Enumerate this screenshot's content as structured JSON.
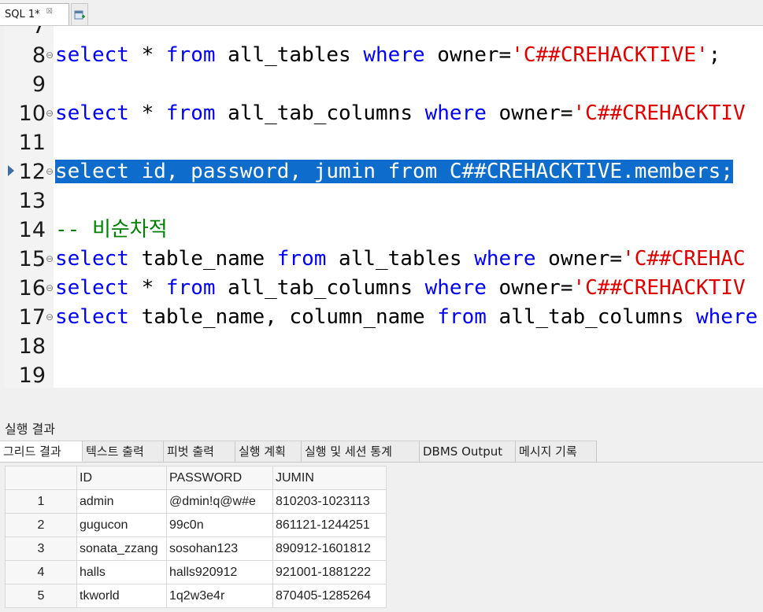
{
  "editor_tab": {
    "label": "SQL 1*",
    "close": "☒"
  },
  "lines": [
    {
      "n": "7",
      "parts": []
    },
    {
      "n": "8",
      "fold": true,
      "parts": [
        {
          "t": "kw",
          "v": "select"
        },
        {
          "t": "plain",
          "v": " * "
        },
        {
          "t": "kw",
          "v": "from"
        },
        {
          "t": "plain",
          "v": " all_tables "
        },
        {
          "t": "kw",
          "v": "where"
        },
        {
          "t": "plain",
          "v": " owner="
        },
        {
          "t": "str",
          "v": "'C##CREHACKTIVE'"
        },
        {
          "t": "plain",
          "v": ";"
        }
      ]
    },
    {
      "n": "9",
      "parts": []
    },
    {
      "n": "10",
      "fold": true,
      "parts": [
        {
          "t": "kw",
          "v": "select"
        },
        {
          "t": "plain",
          "v": " * "
        },
        {
          "t": "kw",
          "v": "from"
        },
        {
          "t": "plain",
          "v": " all_tab_columns "
        },
        {
          "t": "kw",
          "v": "where"
        },
        {
          "t": "plain",
          "v": " owner="
        },
        {
          "t": "str",
          "v": "'C##CREHACKTIV"
        }
      ]
    },
    {
      "n": "11",
      "parts": []
    },
    {
      "n": "12",
      "fold": true,
      "current": true,
      "selected": true,
      "parts": [
        {
          "t": "sel",
          "v": "select id, password, jumin from C##CREHACKTIVE.members;"
        }
      ]
    },
    {
      "n": "13",
      "parts": []
    },
    {
      "n": "14",
      "parts": [
        {
          "t": "cmt",
          "v": "-- 비순차적"
        }
      ]
    },
    {
      "n": "15",
      "fold": true,
      "parts": [
        {
          "t": "kw",
          "v": "select"
        },
        {
          "t": "plain",
          "v": " table_name "
        },
        {
          "t": "kw",
          "v": "from"
        },
        {
          "t": "plain",
          "v": " all_tables "
        },
        {
          "t": "kw",
          "v": "where"
        },
        {
          "t": "plain",
          "v": " owner="
        },
        {
          "t": "str",
          "v": "'C##CREHAC"
        }
      ]
    },
    {
      "n": "16",
      "fold": true,
      "parts": [
        {
          "t": "kw",
          "v": "select"
        },
        {
          "t": "plain",
          "v": " * "
        },
        {
          "t": "kw",
          "v": "from"
        },
        {
          "t": "plain",
          "v": " all_tab_columns "
        },
        {
          "t": "kw",
          "v": "where"
        },
        {
          "t": "plain",
          "v": " owner="
        },
        {
          "t": "str",
          "v": "'C##CREHACKTIV"
        }
      ]
    },
    {
      "n": "17",
      "fold": true,
      "parts": [
        {
          "t": "kw",
          "v": "select"
        },
        {
          "t": "plain",
          "v": " table_name, column_name "
        },
        {
          "t": "kw",
          "v": "from"
        },
        {
          "t": "plain",
          "v": " all_tab_columns "
        },
        {
          "t": "kw",
          "v": "where"
        }
      ]
    },
    {
      "n": "18",
      "parts": []
    },
    {
      "n": "19",
      "parts": []
    }
  ],
  "results": {
    "title": "실행 결과",
    "tabs": [
      "그리드 결과",
      "텍스트 출력",
      "피벗 출력",
      "실행 계획",
      "실행 및 세션 통계",
      "DBMS Output",
      "메시지 기록"
    ],
    "active_tab": 0,
    "columns": [
      "",
      "ID",
      "PASSWORD",
      "JUMIN"
    ],
    "rows": [
      [
        "1",
        "admin",
        "@dmin!q@w#e",
        "810203-1023113"
      ],
      [
        "2",
        "gugucon",
        "99c0n",
        "861121-1244251"
      ],
      [
        "3",
        "sonata_zzang",
        "sosohan123",
        "890912-1601812"
      ],
      [
        "4",
        "halls",
        "halls920912",
        "921001-1881222"
      ],
      [
        "5",
        "tkworld",
        "1q2w3e4r",
        "870405-1285264"
      ]
    ]
  },
  "colors": {
    "keyword": "#0000ff",
    "string": "#e00000",
    "comment": "#008000",
    "selection": "#0e6dcc"
  },
  "icons": {
    "new_tab": "add-tab-icon",
    "scroll_left": "chevron-left-icon"
  }
}
